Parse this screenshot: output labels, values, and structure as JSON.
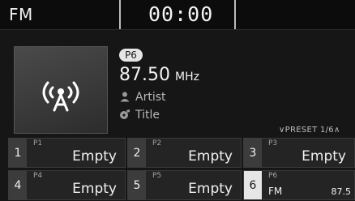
{
  "header": {
    "mode": "FM",
    "clock": "00:00"
  },
  "now_playing": {
    "preset_badge": "P6",
    "frequency": "87.50",
    "unit": "MHz",
    "artist": "Artist",
    "title": "Title",
    "art_icon": "broadcast-icon"
  },
  "presets": {
    "page_indicator": "PRESET 1/6",
    "items": [
      {
        "num": "1",
        "tag": "P1",
        "name": "Empty"
      },
      {
        "num": "2",
        "tag": "P2",
        "name": "Empty"
      },
      {
        "num": "3",
        "tag": "P3",
        "name": "Empty"
      },
      {
        "num": "4",
        "tag": "P4",
        "name": "Empty"
      },
      {
        "num": "5",
        "tag": "P5",
        "name": "Empty"
      },
      {
        "num": "6",
        "tag": "P6",
        "band": "FM",
        "freq": "87.5",
        "active": true
      }
    ]
  },
  "colors": {
    "background": "#161616",
    "text": "#f0f0f0",
    "muted": "#b8b8b8",
    "active_num": "#e6e6e6"
  }
}
